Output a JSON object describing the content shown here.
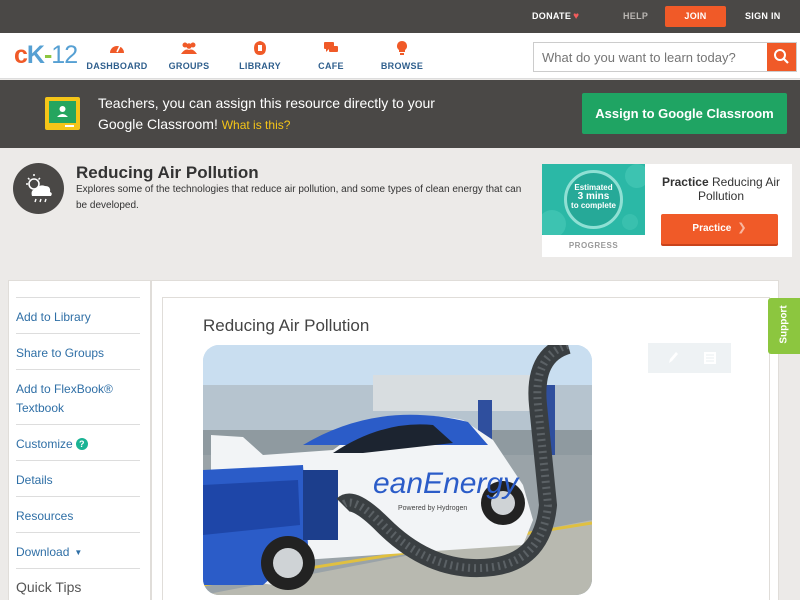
{
  "topbar": {
    "donate": "DONATE",
    "help": "HELP",
    "join": "JOIN",
    "sign_in": "SIGN IN"
  },
  "logo": {
    "c": "c",
    "k": "K",
    "dash": "-",
    "num": "12"
  },
  "nav": [
    {
      "label": "DASHBOARD",
      "icon": "dashboard-icon"
    },
    {
      "label": "GROUPS",
      "icon": "groups-icon"
    },
    {
      "label": "LIBRARY",
      "icon": "library-icon"
    },
    {
      "label": "CAFE",
      "icon": "cafe-icon"
    },
    {
      "label": "BROWSE",
      "icon": "browse-icon"
    }
  ],
  "search": {
    "placeholder": "What do you want to learn today?"
  },
  "classroom": {
    "message": "Teachers, you can assign this resource directly to your Google Classroom!",
    "what_link": "What is this?",
    "button": "Assign to Google Classroom"
  },
  "concept": {
    "title": "Reducing Air Pollution",
    "description": "Explores some of the technologies that reduce air pollution, and some types of clean energy that can be developed."
  },
  "practice_card": {
    "estimate_line1": "Estimated",
    "estimate_line2": "3 mins",
    "estimate_line3": "to complete",
    "progress_label": "PROGRESS",
    "title_prefix": "Practice",
    "title_rest": "Reducing Air Pollution",
    "button": "Practice"
  },
  "sidebar": {
    "items": [
      {
        "label": "Add to Library"
      },
      {
        "label": "Share to Groups"
      },
      {
        "label": "Add to FlexBook® Textbook"
      },
      {
        "label": "Customize"
      },
      {
        "label": "Details"
      },
      {
        "label": "Resources"
      },
      {
        "label": "Download"
      }
    ],
    "quick_tips": "Quick Tips"
  },
  "article": {
    "title": "Reducing Air Pollution",
    "photo_text": "eanEnergy",
    "photo_subtext": "Powered by Hydrogen"
  },
  "support": "Support",
  "colors": {
    "orange": "#f05a28",
    "dark": "#4a4846",
    "green": "#1fa463",
    "support_green": "#8cc63f",
    "link_blue": "#2f6fa6"
  }
}
